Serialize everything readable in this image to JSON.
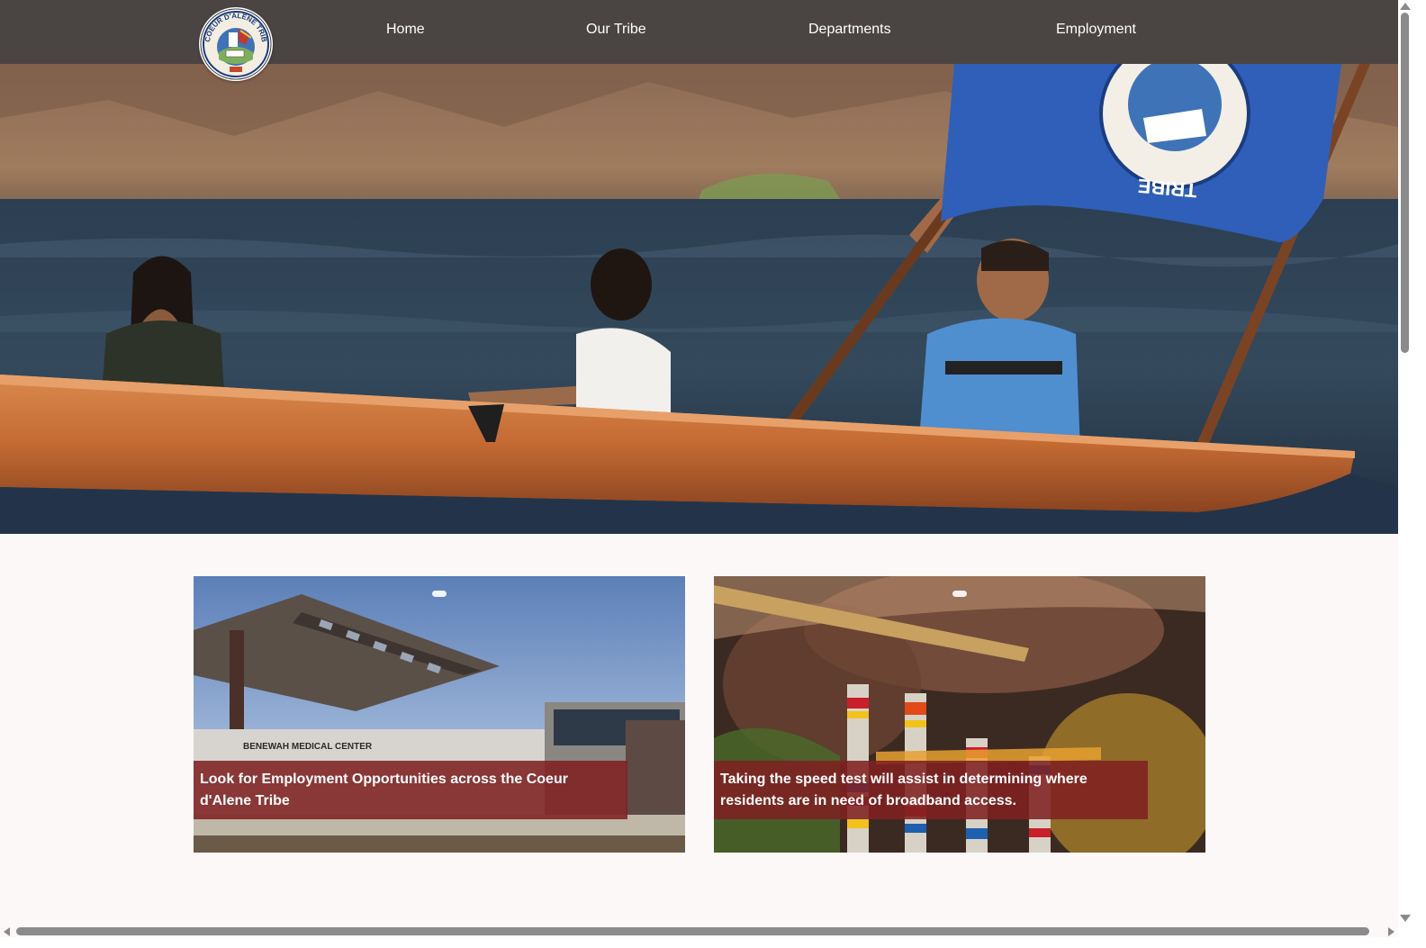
{
  "header": {
    "logo": {
      "ring_text": "COEUR D'ALENE TRIBE",
      "background_color": "#4a4542"
    },
    "nav": [
      {
        "label": "Home"
      },
      {
        "label": "Our Tribe"
      },
      {
        "label": "Departments"
      },
      {
        "label": "Employment"
      }
    ]
  },
  "hero": {
    "image": "canoe-paddlers-with-tribal-flag",
    "flag_text": "TRIBE"
  },
  "cards": [
    {
      "image": "benewah-medical-center-building",
      "sign_text": "BENEWAH MEDICAL CENTER",
      "caption": "Look for Employment Opportunities across the Coeur d'Alene Tribe"
    },
    {
      "image": "drummers-with-beaded-sticks",
      "caption": "Taking the speed test will assist in determining where residents are in need of broadband access."
    }
  ],
  "colors": {
    "header_bg": "#4a4542",
    "caption_bg": "#7f2121",
    "page_bg": "#fcf8f7"
  }
}
